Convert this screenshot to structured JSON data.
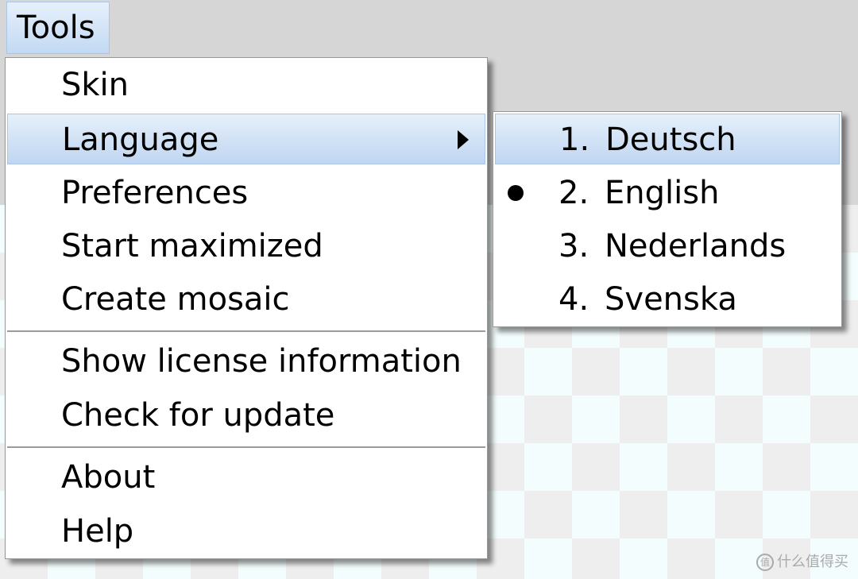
{
  "menubar": {
    "tools_label": "Tools"
  },
  "tools_menu": {
    "items": [
      {
        "label": "Skin"
      },
      {
        "label": "Language"
      },
      {
        "label": "Preferences"
      },
      {
        "label": "Start maximized"
      },
      {
        "label": "Create mosaic"
      },
      {
        "label": "Show license information"
      },
      {
        "label": "Check for update"
      },
      {
        "label": "About"
      },
      {
        "label": "Help"
      }
    ]
  },
  "language_menu": {
    "items": [
      {
        "number": "1.",
        "label": "Deutsch"
      },
      {
        "number": "2.",
        "label": "English",
        "selected": true
      },
      {
        "number": "3.",
        "label": "Nederlands"
      },
      {
        "number": "4.",
        "label": "Svenska"
      }
    ]
  },
  "watermark": {
    "text": "什么值得买"
  },
  "colors": {
    "highlight_top": "#e6f0fb",
    "highlight_bottom": "#bfd6f1",
    "highlight_border": "#a9c6e8",
    "toolbar_bg": "#d6d6d6"
  }
}
